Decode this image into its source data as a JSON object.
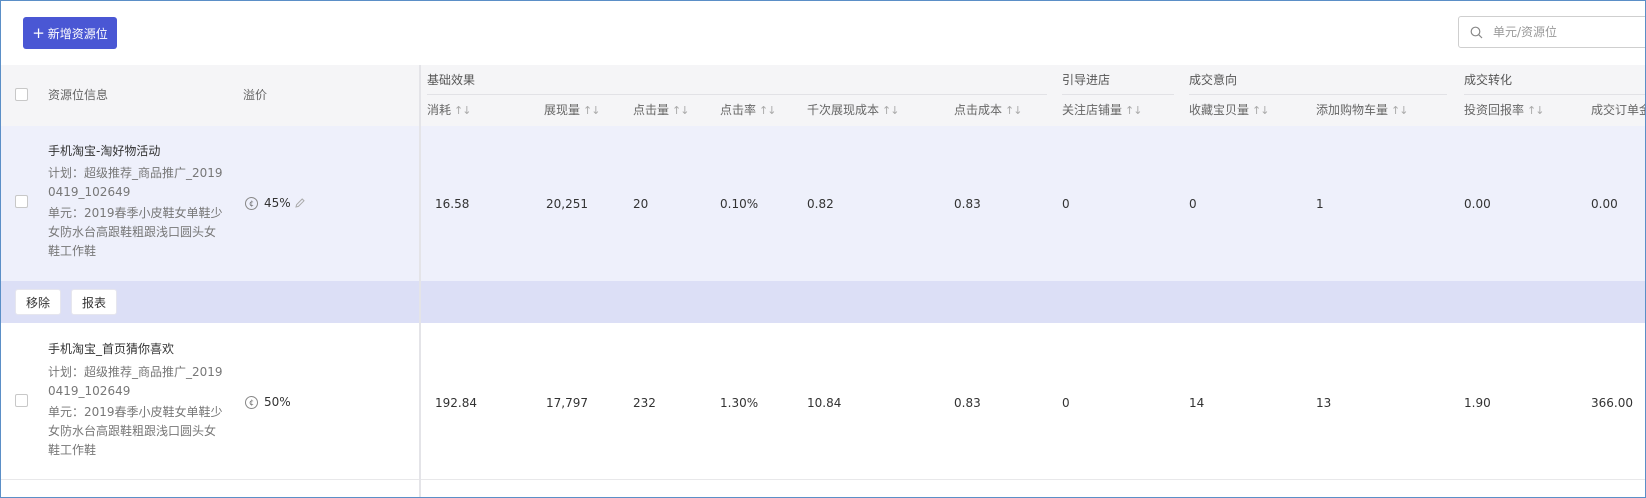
{
  "toolbar": {
    "add_label": "新增资源位",
    "search_placeholder": "单元/资源位"
  },
  "header": {
    "info_label": "资源位信息",
    "premium_label": "溢价",
    "groups": [
      "基础效果",
      "引导进店",
      "成交意向",
      "成交转化"
    ],
    "columns": [
      "消耗",
      "展现量",
      "点击量",
      "点击率",
      "千次展现成本",
      "点击成本",
      "关注店铺量",
      "收藏宝贝量",
      "添加购物车量",
      "投资回报率",
      "成交订单金额"
    ],
    "sort_glyph": "↑↓"
  },
  "rows": [
    {
      "title": "手机淘宝-淘好物活动",
      "plan": "计划：超级推荐_商品推广_20190419_102649",
      "unit": "单元：2019春季小皮鞋女单鞋少女防水台高跟鞋粗跟浅口圆头女鞋工作鞋",
      "premium": "45%",
      "values": [
        "16.58",
        "20,251",
        "20",
        "0.10%",
        "0.82",
        "0.83",
        "0",
        "0",
        "1",
        "0.00",
        "0.00"
      ]
    },
    {
      "title": "手机淘宝_首页猜你喜欢",
      "plan": "计划：超级推荐_商品推广_20190419_102649",
      "unit": "单元：2019春季小皮鞋女单鞋少女防水台高跟鞋粗跟浅口圆头女鞋工作鞋",
      "premium": "50%",
      "values": [
        "192.84",
        "17,797",
        "232",
        "1.30%",
        "10.84",
        "0.83",
        "0",
        "14",
        "13",
        "1.90",
        "366.00"
      ]
    }
  ],
  "actions": {
    "remove_label": "移除",
    "report_label": "报表"
  },
  "colors": {
    "accent": "#4a57d4",
    "row_highlight": "#eef0fb",
    "action_bar": "#dcdff6"
  }
}
